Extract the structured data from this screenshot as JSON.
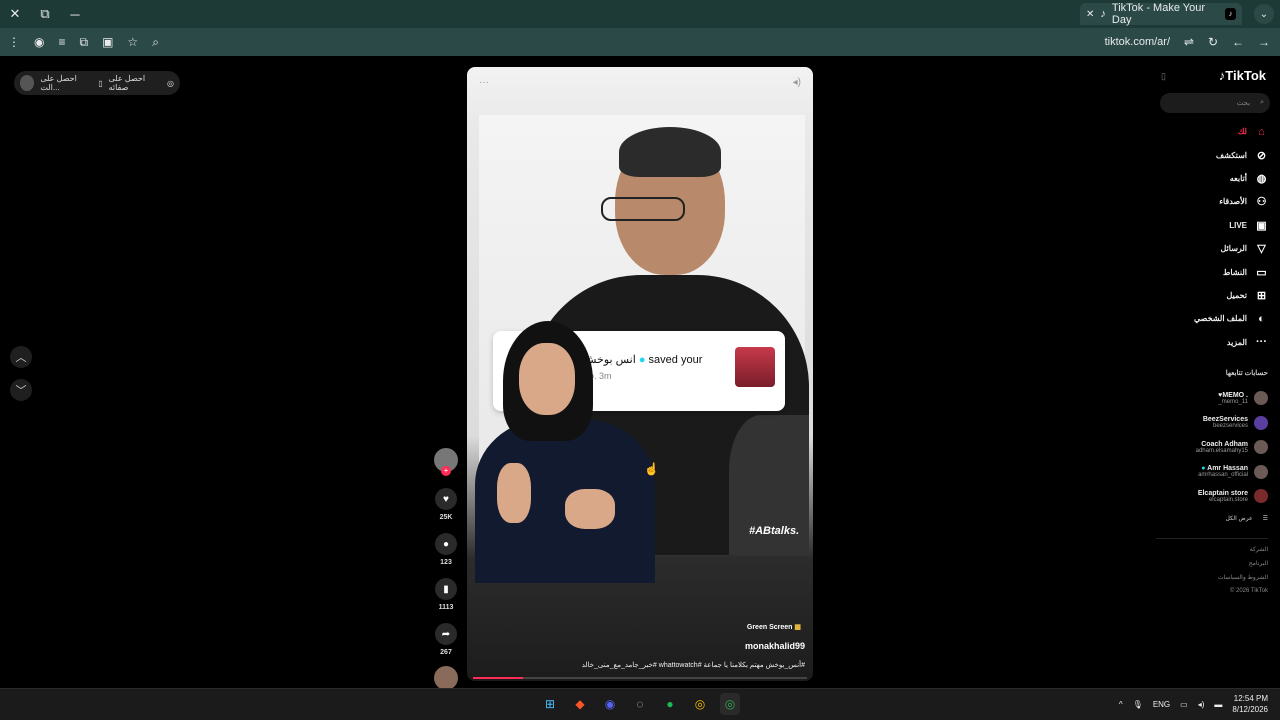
{
  "browser": {
    "tab_title": "TikTok - Make Your Day",
    "url": "tiktok.com/ar/"
  },
  "top_pill": {
    "label_1": "احصل على الت...",
    "label_2": "احصل على صفائه"
  },
  "video": {
    "notification_name": "انس بوخش",
    "notification_text": "saved your",
    "notification_time": "3m",
    "notification_prefix": "o.",
    "hashtag_overlay": "#ABtalks.",
    "green_screen": "Green Screen",
    "username": "monakhalid99",
    "caption": "#أنس_بوخش مهتم بكلامنا يا جماعة #whattowatch #خبر_جامد_مع_منى_خالد",
    "progress": 0.15
  },
  "actions": {
    "likes": "25K",
    "comments": "123",
    "saves": "1113",
    "shares": "267"
  },
  "sidebar": {
    "logo": "TikTok",
    "search_placeholder": "بحث",
    "menu": [
      {
        "label": "لك",
        "icon": "home-icon"
      },
      {
        "label": "استكشف",
        "icon": "compass-icon"
      },
      {
        "label": "أتابعه",
        "icon": "following-icon"
      },
      {
        "label": "الأصدقاء",
        "icon": "friends-icon"
      },
      {
        "label": "LIVE",
        "icon": "live-icon"
      },
      {
        "label": "الرسائل",
        "icon": "messages-icon"
      },
      {
        "label": "النشاط",
        "icon": "activity-icon"
      },
      {
        "label": "تحميل",
        "icon": "upload-icon"
      },
      {
        "label": "الملف الشخصي",
        "icon": "profile-icon"
      },
      {
        "label": "المزيد",
        "icon": "more-icon"
      }
    ],
    "following_title": "حسابات تتابعها",
    "following": [
      {
        "name": "♥MEMO .",
        "handle": "_memo_11"
      },
      {
        "name": "BeezServices",
        "handle": "beezservices"
      },
      {
        "name": "Coach Adham",
        "handle": "adham.elsamahy15"
      },
      {
        "name": "Amr Hassan",
        "handle": "amrhassan_official"
      },
      {
        "name": "Elcaptain store",
        "handle": "elcaptain.store"
      }
    ],
    "see_all": "عرض الكل",
    "footer": [
      "الشركة",
      "البرنامج",
      "الشروط والسياسات",
      "© 2026 TikTok"
    ]
  },
  "taskbar": {
    "lang": "ENG",
    "time": "12:54 PM",
    "date": "8/12/2026"
  }
}
